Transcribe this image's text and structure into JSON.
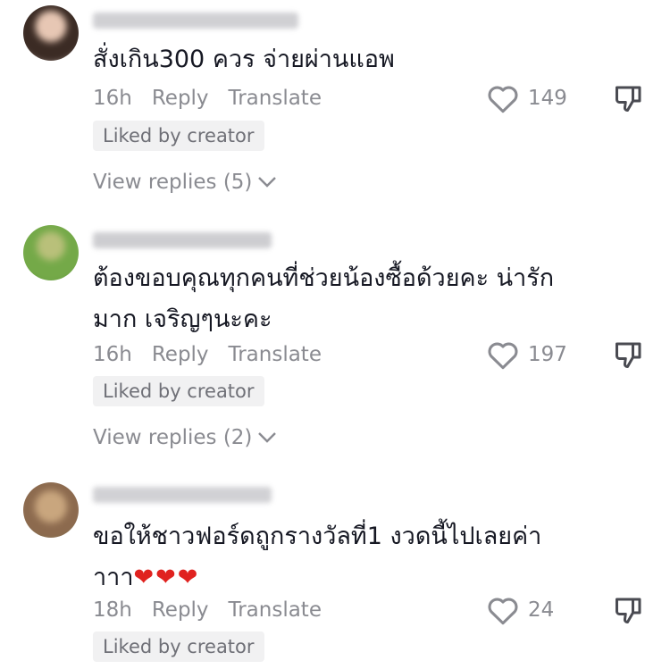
{
  "comments": [
    {
      "text": "สั่งเกิน300 ควร จ่ายผ่านแอพ",
      "time": "16h",
      "reply_label": "Reply",
      "translate_label": "Translate",
      "likes": "149",
      "badge": "Liked by creator",
      "view_replies": "View replies (5)"
    },
    {
      "text": "ต้องขอบคุณทุกคนที่ช่วยน้องซื้อด้วยคะ น่ารัก\nมาก เจริญๆนะคะ",
      "time": "16h",
      "reply_label": "Reply",
      "translate_label": "Translate",
      "likes": "197",
      "badge": "Liked by creator",
      "view_replies": "View replies (2)"
    },
    {
      "text": "ขอให้ชาวฟอร์ดถูกรางวัลที่1 งวดนี้ไปเลยค่า\nาาา",
      "hearts": "❤❤❤",
      "time": "18h",
      "reply_label": "Reply",
      "translate_label": "Translate",
      "likes": "24",
      "badge": "Liked by creator"
    }
  ],
  "icons": {
    "like": "heart-outline-icon",
    "dislike": "thumbs-down-icon",
    "expand": "chevron-down-icon"
  },
  "colors": {
    "text": "#161823",
    "muted": "#8a8b91",
    "badge_bg": "#f1f1f2",
    "heart": "#e0221f"
  }
}
